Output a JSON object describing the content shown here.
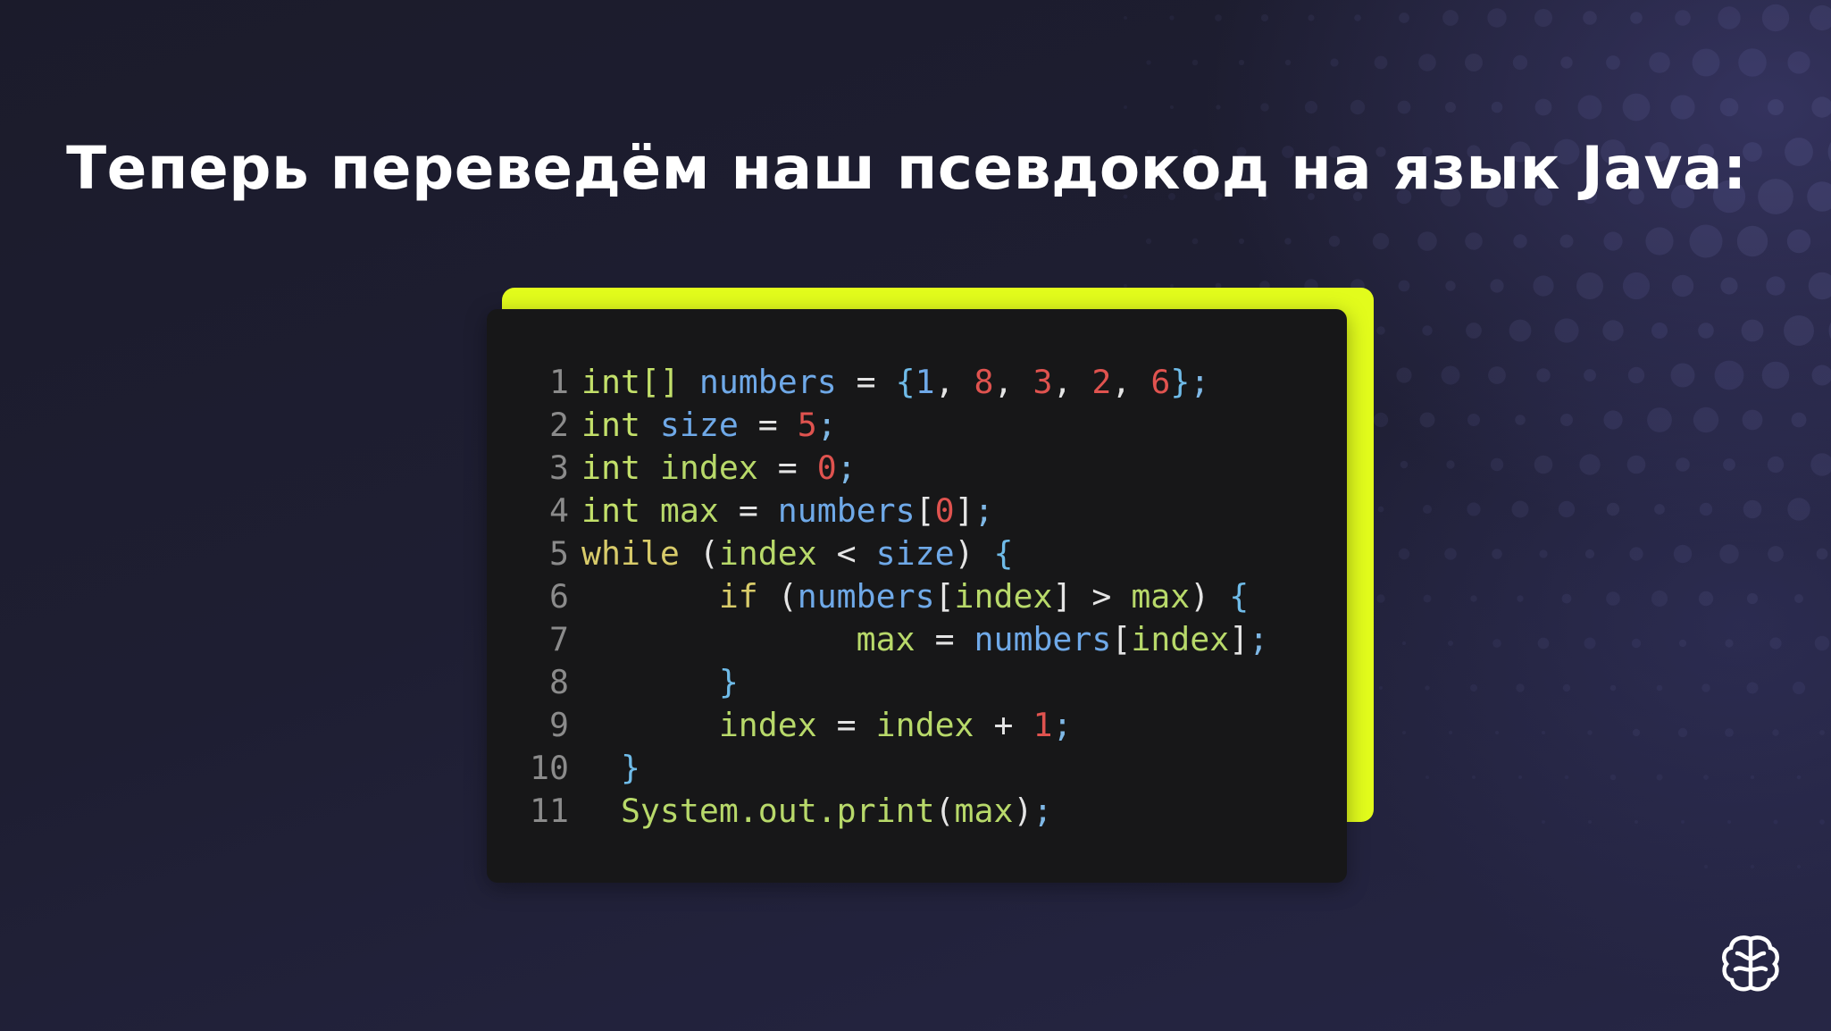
{
  "slide": {
    "title": "Теперь переведём наш псевдокод на язык Java:"
  },
  "code_block": {
    "language": "Java",
    "lines": [
      {
        "n": "1",
        "tokens": [
          [
            "int[]",
            "type"
          ],
          [
            " ",
            "p"
          ],
          [
            "numbers",
            "id"
          ],
          [
            " = ",
            "p"
          ],
          [
            "{",
            "brace"
          ],
          [
            "1",
            "id"
          ],
          [
            ", ",
            "p"
          ],
          [
            "8",
            "num"
          ],
          [
            ", ",
            "p"
          ],
          [
            "3",
            "num"
          ],
          [
            ", ",
            "p"
          ],
          [
            "2",
            "num"
          ],
          [
            ", ",
            "p"
          ],
          [
            "6",
            "num"
          ],
          [
            "}",
            "brace"
          ],
          [
            ";",
            "semi"
          ]
        ]
      },
      {
        "n": "2",
        "tokens": [
          [
            "int",
            "type"
          ],
          [
            " ",
            "p"
          ],
          [
            "size",
            "id"
          ],
          [
            " = ",
            "p"
          ],
          [
            "5",
            "num"
          ],
          [
            ";",
            "semi"
          ]
        ]
      },
      {
        "n": "3",
        "tokens": [
          [
            "int",
            "type"
          ],
          [
            " ",
            "p"
          ],
          [
            "index",
            "var"
          ],
          [
            " = ",
            "p"
          ],
          [
            "0",
            "num"
          ],
          [
            ";",
            "semi"
          ]
        ]
      },
      {
        "n": "4",
        "tokens": [
          [
            "int",
            "type"
          ],
          [
            " ",
            "p"
          ],
          [
            "max",
            "var"
          ],
          [
            " = ",
            "p"
          ],
          [
            "numbers",
            "id"
          ],
          [
            "[",
            "p"
          ],
          [
            "0",
            "num"
          ],
          [
            "]",
            "p"
          ],
          [
            ";",
            "semi"
          ]
        ]
      },
      {
        "n": "5",
        "tokens": [
          [
            "while",
            "kw"
          ],
          [
            " (",
            "p"
          ],
          [
            "index",
            "var"
          ],
          [
            " < ",
            "p"
          ],
          [
            "size",
            "id"
          ],
          [
            ") ",
            "p"
          ],
          [
            "{",
            "brace"
          ]
        ]
      },
      {
        "n": "6",
        "tokens": [
          [
            "       ",
            "p"
          ],
          [
            "if",
            "kw"
          ],
          [
            " (",
            "p"
          ],
          [
            "numbers",
            "id"
          ],
          [
            "[",
            "p"
          ],
          [
            "index",
            "var"
          ],
          [
            "] > ",
            "p"
          ],
          [
            "max",
            "var"
          ],
          [
            ") ",
            "p"
          ],
          [
            "{",
            "brace"
          ]
        ]
      },
      {
        "n": "7",
        "tokens": [
          [
            "              ",
            "p"
          ],
          [
            "max",
            "var"
          ],
          [
            " = ",
            "p"
          ],
          [
            "numbers",
            "id"
          ],
          [
            "[",
            "p"
          ],
          [
            "index",
            "var"
          ],
          [
            "]",
            "p"
          ],
          [
            ";",
            "semi"
          ]
        ]
      },
      {
        "n": "8",
        "tokens": [
          [
            "       ",
            "p"
          ],
          [
            "}",
            "brace"
          ]
        ]
      },
      {
        "n": "9",
        "tokens": [
          [
            "       ",
            "p"
          ],
          [
            "index",
            "var"
          ],
          [
            " = ",
            "p"
          ],
          [
            "index",
            "var"
          ],
          [
            " + ",
            "p"
          ],
          [
            "1",
            "num"
          ],
          [
            ";",
            "semi"
          ]
        ]
      },
      {
        "n": "10",
        "tokens": [
          [
            "  ",
            "p"
          ],
          [
            "}",
            "brace"
          ]
        ]
      },
      {
        "n": "11",
        "tokens": [
          [
            "  ",
            "p"
          ],
          [
            "System.out.print",
            "var"
          ],
          [
            "(",
            "p"
          ],
          [
            "max",
            "var"
          ],
          [
            ")",
            "p"
          ],
          [
            ";",
            "semi"
          ]
        ]
      }
    ]
  },
  "colors": {
    "accent": "#e2fc1c",
    "code_background": "#171718",
    "background": "#1e1e32",
    "title": "#ffffff"
  },
  "icons": {
    "logo": "brain-icon"
  }
}
